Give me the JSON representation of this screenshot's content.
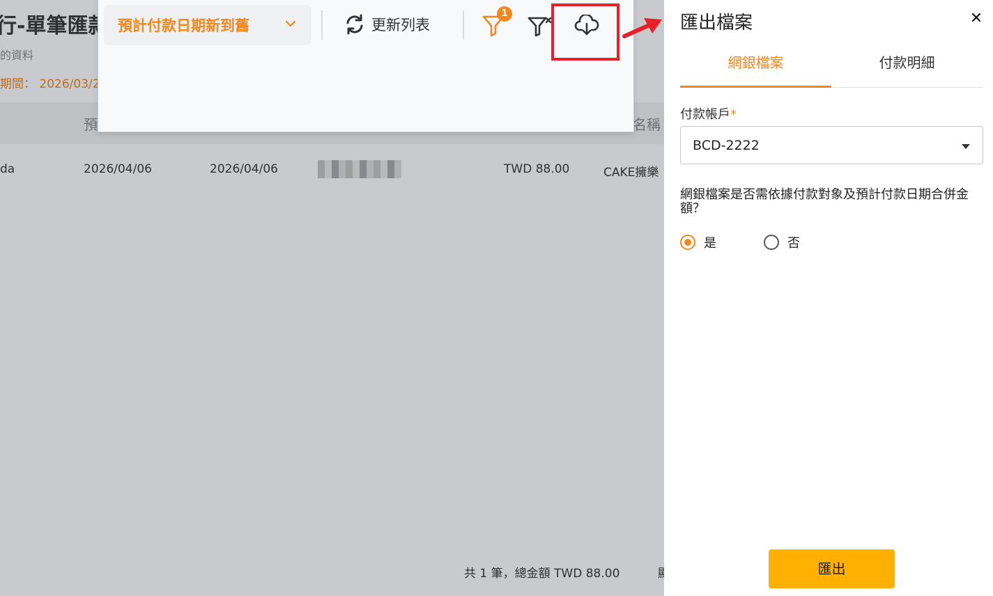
{
  "background": {
    "title": "行-單筆匯款",
    "subtitle": "的資料",
    "period": "期間： 2026/03/2",
    "table_headers": [
      "預",
      "名稱"
    ],
    "row": {
      "col1": "da",
      "date1": "2026/04/06",
      "date2": "2026/04/06",
      "amount": "TWD 88.00",
      "payee": "CAKE擁樂"
    },
    "summary": "共 1 筆，總金額 TWD 88.00",
    "footer_cut": "顯"
  },
  "toolbar": {
    "sort_label": "預計付款日期新到舊",
    "refresh_label": "更新列表",
    "filter_badge": "1"
  },
  "drawer": {
    "title": "匯出檔案",
    "tabs": [
      {
        "label": "網銀檔案",
        "active": true
      },
      {
        "label": "付款明細",
        "active": false
      }
    ],
    "account_label": "付款帳戶",
    "required_mark": "*",
    "account_value": "BCD-2222",
    "question": "網銀檔案是否需依據付款對象及預計付款日期合併金額？",
    "options": [
      {
        "label": "是",
        "checked": true
      },
      {
        "label": "否",
        "checked": false
      }
    ],
    "export_label": "匯出"
  },
  "colors": {
    "accent": "#f0871f",
    "export_button": "#ffb000",
    "highlight": "#e8202a"
  }
}
